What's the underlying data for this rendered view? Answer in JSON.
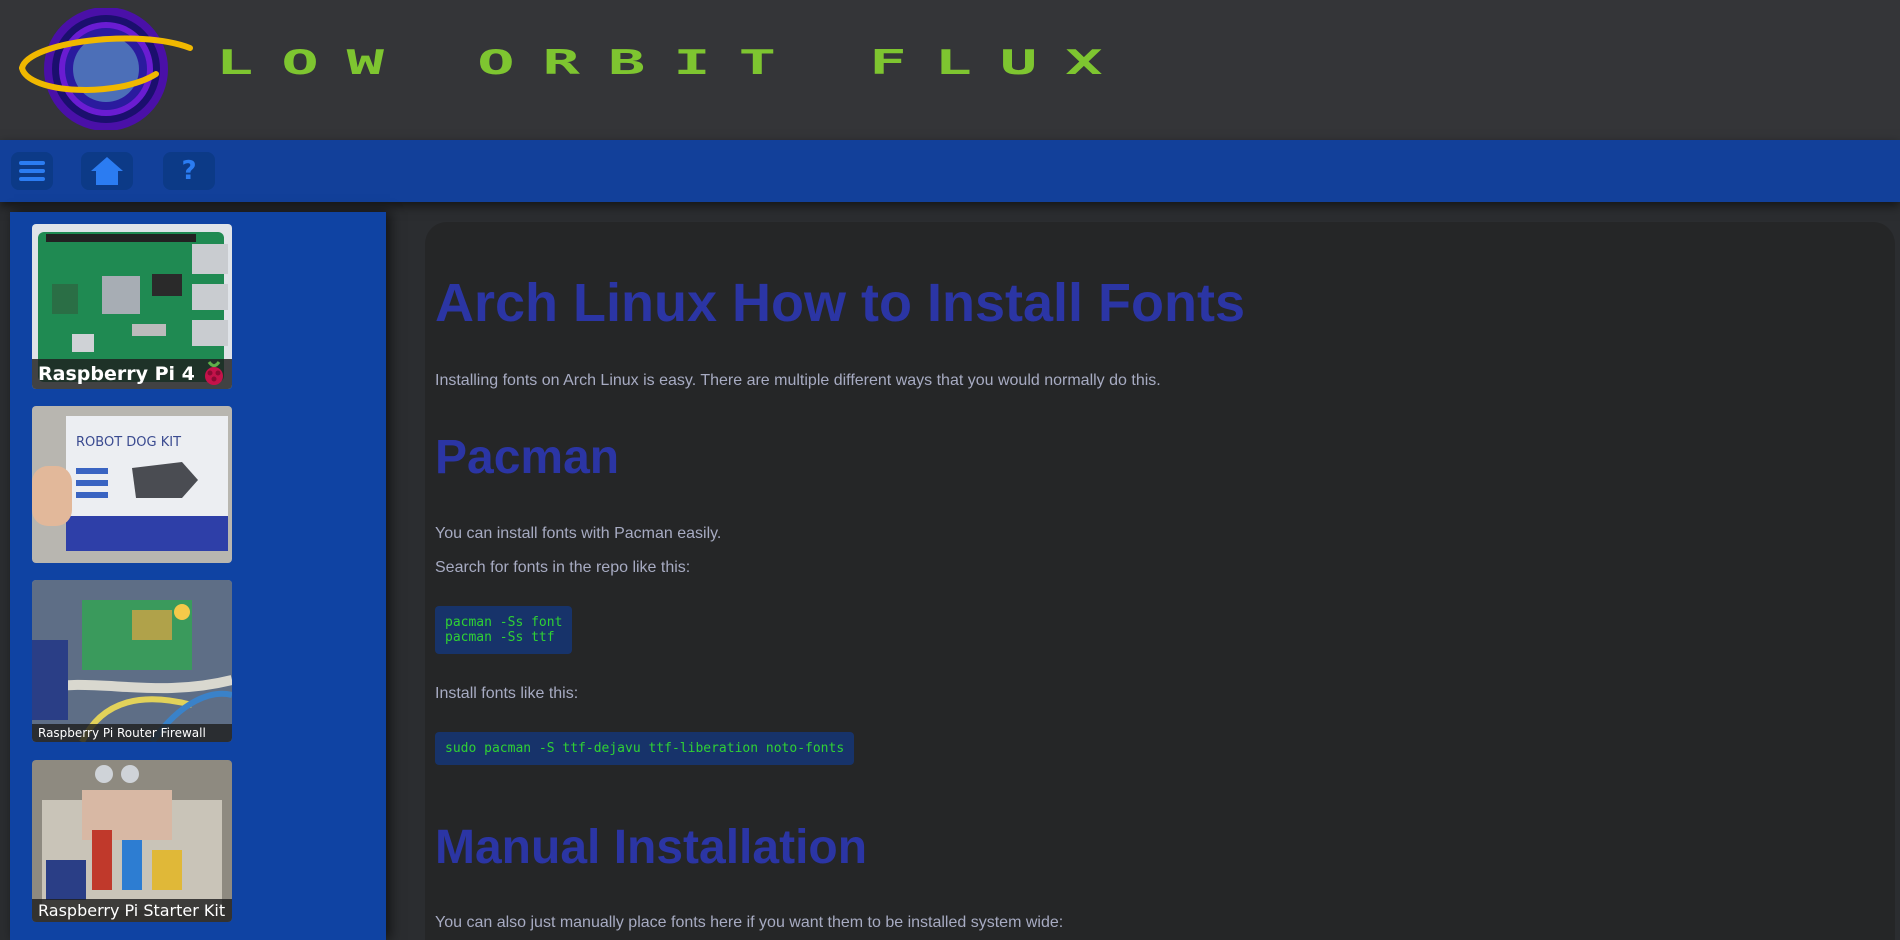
{
  "header": {
    "site_title": "Low Orbit Flux"
  },
  "nav": {
    "menu_icon": "hamburger-icon",
    "home_icon": "home-icon",
    "help_label": "?"
  },
  "sidebar": {
    "cards": [
      {
        "label": "Raspberry Pi 4",
        "image": "raspberry-pi-4-board-photo"
      },
      {
        "label": "",
        "image": "robot-dog-kit-box-photo"
      },
      {
        "label": "Raspberry Pi Router Firewall",
        "image": "raspberry-pi-router-photo"
      },
      {
        "label": "Raspberry Pi Starter Kit",
        "image": "raspberry-pi-starter-kit-photo"
      }
    ]
  },
  "article": {
    "title": "Arch Linux How to Install Fonts",
    "intro": "Installing fonts on Arch Linux is easy. There are multiple different ways that you would normally do this.",
    "pacman_heading": "Pacman",
    "pacman_p1": "You can install fonts with Pacman easily.",
    "pacman_p2": "Search for fonts in the repo like this:",
    "code_search": "pacman -Ss font\npacman -Ss ttf",
    "install_p": "Install fonts like this:",
    "code_install": "sudo pacman -S ttf-dejavu ttf-liberation noto-fonts",
    "manual_heading": "Manual Installation",
    "manual_p": "You can also just manually place fonts here if you want them to be installed system wide:"
  },
  "colors": {
    "header_bg": "#343538",
    "nav_bg": "#12409a",
    "title_green": "#7ec530",
    "heading_blue": "#2b35a4",
    "code_green": "#2fd134"
  }
}
